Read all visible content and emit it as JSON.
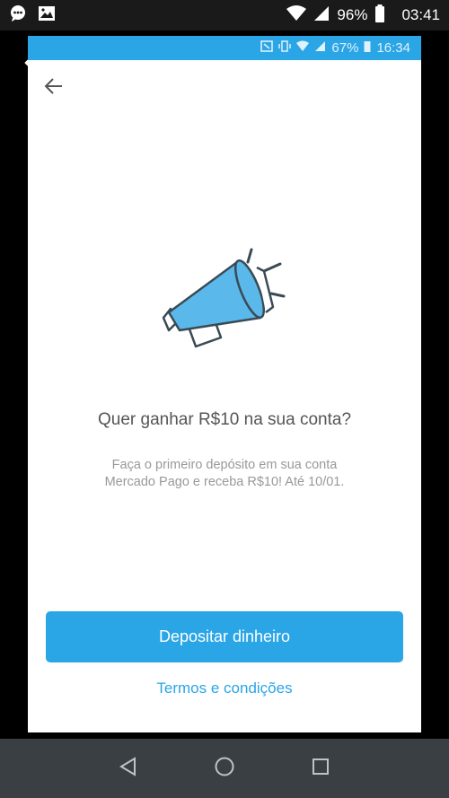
{
  "device_status": {
    "battery": "96%",
    "time": "03:41"
  },
  "inner_status": {
    "battery": "67%",
    "time": "16:34"
  },
  "promo": {
    "headline": "Quer ganhar R$10 na sua conta?",
    "subtext_line1": "Faça o primeiro depósito em sua conta",
    "subtext_line2": "Mercado Pago e receba R$10! Até 10/01."
  },
  "actions": {
    "cta_label": "Depositar dinheiro",
    "terms_label": "Termos e condições"
  },
  "icons": {
    "back": "arrow-left-icon",
    "illustration": "megaphone-icon"
  },
  "colors": {
    "accent": "#2aa5e6",
    "megaphone_fill": "#5ab9ea"
  }
}
